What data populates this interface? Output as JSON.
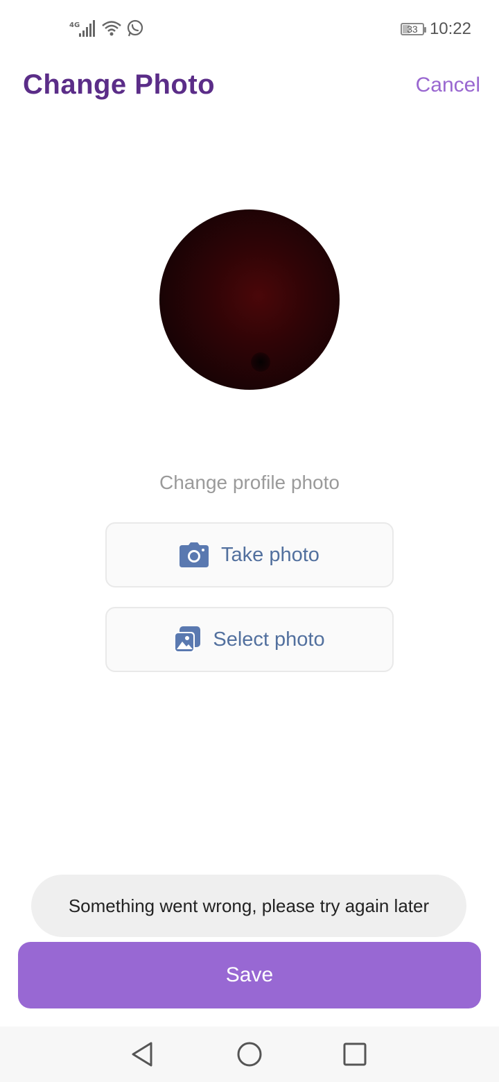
{
  "status_bar": {
    "network_label": "4G",
    "battery_level": "33",
    "time": "10:22",
    "icons": [
      "signal-icon",
      "wifi-icon",
      "whatsapp-icon",
      "battery-icon"
    ]
  },
  "header": {
    "title": "Change Photo",
    "cancel_label": "Cancel"
  },
  "main": {
    "subtitle": "Change profile photo",
    "take_photo_label": "Take photo",
    "select_photo_label": "Select photo"
  },
  "toast": {
    "message": "Something went wrong, please try again later"
  },
  "footer": {
    "save_label": "Save"
  },
  "nav_bar": {
    "icons": [
      "back-icon",
      "home-icon",
      "recent-apps-icon"
    ]
  },
  "colors": {
    "title": "#5b2d88",
    "accent": "#9967d0",
    "save_button": "#9868d3",
    "option_text": "#52709e",
    "toast_bg": "#efefef"
  }
}
